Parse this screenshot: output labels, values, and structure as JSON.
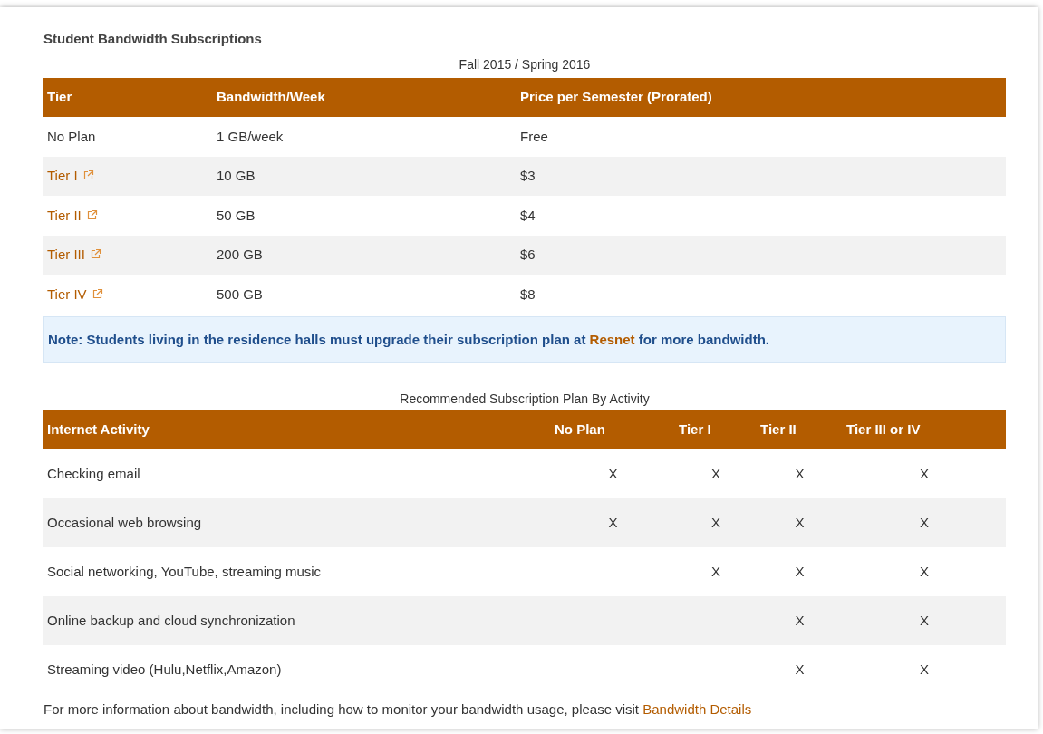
{
  "heading": "Student Bandwidth Subscriptions",
  "plans_table": {
    "caption": "Fall 2015 / Spring 2016",
    "columns": [
      "Tier",
      "Bandwidth/Week",
      "Price per Semester (Prorated)"
    ],
    "rows": [
      {
        "cells": [
          "No Plan",
          "1 GB/week",
          "Free"
        ],
        "link": false
      },
      {
        "cells": [
          "Tier I",
          "10 GB",
          "$3"
        ],
        "link": true
      },
      {
        "cells": [
          "Tier II",
          "50 GB",
          "$4"
        ],
        "link": true
      },
      {
        "cells": [
          "Tier III",
          "200 GB",
          "$6"
        ],
        "link": true
      },
      {
        "cells": [
          "Tier IV",
          "500 GB",
          "$8"
        ],
        "link": true
      }
    ]
  },
  "note": {
    "before": "Note: Students living in the residence halls must upgrade their subscription plan at",
    "link": "Resnet",
    "after": "for more bandwidth."
  },
  "activity_table": {
    "caption": "Recommended Subscription Plan By Activity",
    "columns": [
      "Internet Activity",
      "No Plan",
      "Tier I",
      "Tier II",
      "Tier III or IV"
    ],
    "rows": [
      {
        "activity": "Checking email",
        "marks": {
          "no_plan": "X",
          "tier_1": "X",
          "tier_2": "X",
          "tier_3_or_4": "X"
        }
      },
      {
        "activity": "Occasional web browsing",
        "marks": {
          "no_plan": "X",
          "tier_1": "X",
          "tier_2": "X",
          "tier_3_or_4": "X"
        }
      },
      {
        "activity": "Social networking, YouTube, streaming music",
        "marks": {
          "tier_1": "X",
          "tier_2": "X",
          "tier_3_or_4": "X"
        }
      },
      {
        "activity": "Online backup and cloud synchronization",
        "marks": {
          "tier_2": "X",
          "tier_3_or_4": "X"
        }
      },
      {
        "activity": "Streaming video (Hulu,Netflix,Amazon)",
        "marks": {
          "tier_2": "X",
          "tier_3_or_4": "X"
        }
      }
    ]
  },
  "footer": {
    "text": "For more information about bandwidth, including how to monitor your bandwidth usage, please visit",
    "link": "Bandwidth Details"
  }
}
